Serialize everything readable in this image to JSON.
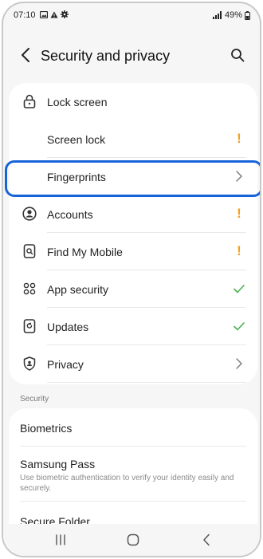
{
  "status_bar": {
    "time": "07:10",
    "battery": "49%"
  },
  "header": {
    "title": "Security and privacy"
  },
  "main_list": [
    {
      "label": "Lock screen",
      "icon": "lock-icon",
      "trailing": "none"
    },
    {
      "label": "Screen lock",
      "icon": "none",
      "trailing": "warning"
    },
    {
      "label": "Fingerprints",
      "icon": "none",
      "trailing": "chevron"
    },
    {
      "label": "Accounts",
      "icon": "account-icon",
      "trailing": "warning"
    },
    {
      "label": "Find My Mobile",
      "icon": "find-mobile-icon",
      "trailing": "warning"
    },
    {
      "label": "App security",
      "icon": "app-security-icon",
      "trailing": "check"
    },
    {
      "label": "Updates",
      "icon": "updates-icon",
      "trailing": "check"
    },
    {
      "label": "Privacy",
      "icon": "privacy-icon",
      "trailing": "chevron"
    }
  ],
  "section": {
    "label": "Security"
  },
  "security_list": [
    {
      "title": "Biometrics"
    },
    {
      "title": "Samsung Pass",
      "description": "Use biometric authentication to verify your identity easily and securely."
    },
    {
      "title": "Secure Folder"
    }
  ],
  "colors": {
    "warning": "#f2a21d",
    "check": "#4caf50",
    "highlight": "#1764d9"
  }
}
